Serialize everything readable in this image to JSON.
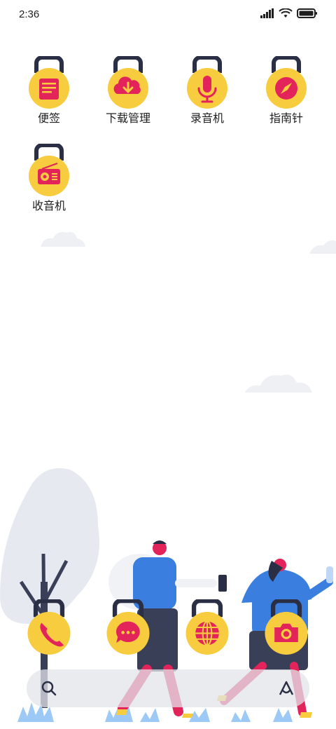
{
  "status_bar": {
    "time": "2:36",
    "icons": [
      "signal-icon",
      "wifi-icon",
      "battery-icon"
    ]
  },
  "apps": [
    {
      "label": "便签",
      "icon": "note-icon"
    },
    {
      "label": "下载管理",
      "icon": "cloud-download-icon"
    },
    {
      "label": "录音机",
      "icon": "microphone-icon"
    },
    {
      "label": "指南针",
      "icon": "compass-icon"
    },
    {
      "label": "收音机",
      "icon": "radio-icon"
    }
  ],
  "dock": [
    {
      "icon": "phone-icon"
    },
    {
      "icon": "message-icon"
    },
    {
      "icon": "browser-icon"
    },
    {
      "icon": "camera-icon"
    }
  ],
  "search": {
    "left_icon": "search-icon",
    "right_icon": "assistant-icon"
  },
  "colors": {
    "lock_body": "#F7CC3F",
    "lock_shackle": "#2B2F45",
    "glyph": "#E3245A",
    "person_shirt": "#3A7FE0",
    "person_pants": "#E3245A",
    "tree": "#E6E9EF"
  }
}
